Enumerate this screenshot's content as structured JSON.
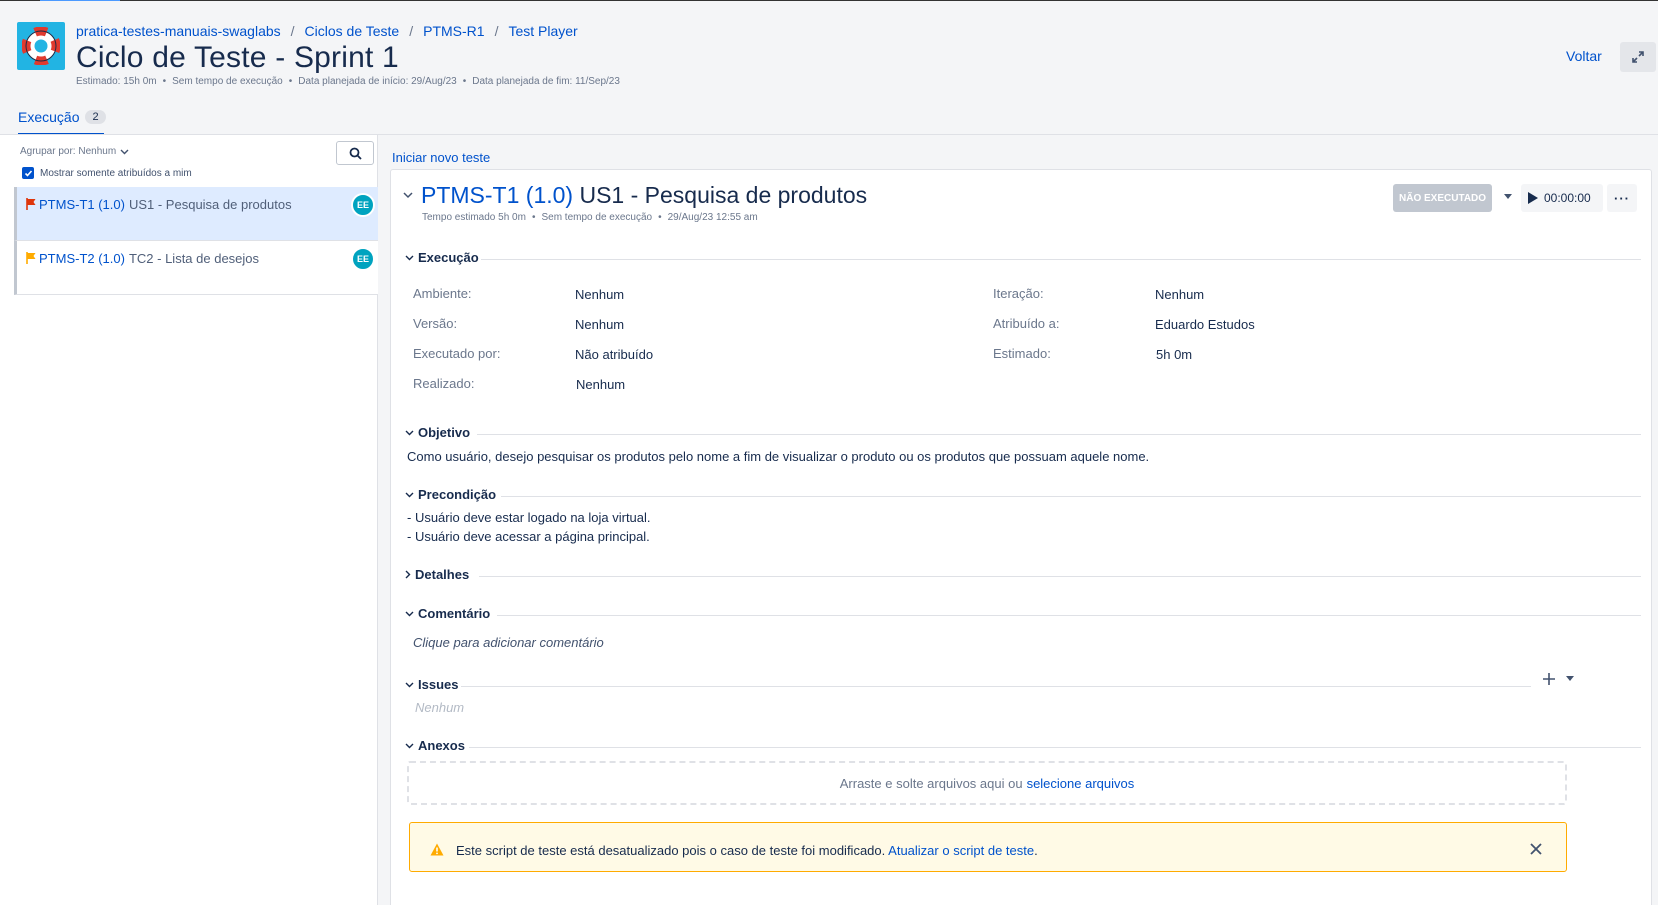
{
  "breadcrumb": {
    "project": "pratica-testes-manuais-swaglabs",
    "cycles": "Ciclos de Teste",
    "cycle_key": "PTMS-R1",
    "player": "Test Player",
    "sep": "/"
  },
  "header": {
    "title": "Ciclo de Teste - Sprint 1",
    "estimated": "Estimado: 15h 0m",
    "no_exec_time": "Sem tempo de execução",
    "planned_start": "Data planejada de início: 29/Aug/23",
    "planned_end": "Data planejada de fim: 11/Sep/23",
    "back": "Voltar"
  },
  "tabs": {
    "execution_label": "Execução",
    "execution_count": "2"
  },
  "sidebar": {
    "group_by": "Agrupar por: Nenhum",
    "only_assigned": "Mostrar somente atribuídos a mim",
    "items": [
      {
        "key": "PTMS-T1 (1.0)",
        "title": "US1 - Pesquisa de produtos",
        "avatar": "EE",
        "flag_color": "#de350b"
      },
      {
        "key": "PTMS-T2 (1.0)",
        "title": "TC2 - Lista de desejos",
        "avatar": "EE",
        "flag_color": "#ffab00"
      }
    ]
  },
  "main": {
    "new_test": "Iniciar novo teste",
    "test_key": "PTMS-T1 (1.0)",
    "test_title": "US1 - Pesquisa de produtos",
    "meta_estimated": "Tempo estimado 5h 0m",
    "meta_no_exec": "Sem tempo de execução",
    "meta_date": "29/Aug/23 12:55 am",
    "status": "NÃO EXECUTADO",
    "timer": "00:00:00",
    "more": "···",
    "execution": {
      "heading": "Execução",
      "environment_label": "Ambiente:",
      "environment_value": "Nenhum",
      "version_label": "Versão:",
      "version_value": "Nenhum",
      "executed_by_label": "Executado por:",
      "executed_by_value": "Não atribuído",
      "done_label": "Realizado:",
      "done_value": "Nenhum",
      "iteration_label": "Iteração:",
      "iteration_value": "Nenhum",
      "assigned_label": "Atribuído a:",
      "assigned_value": "Eduardo Estudos",
      "estimated_label": "Estimado:",
      "estimated_value": "5h 0m"
    },
    "objective": {
      "heading": "Objetivo",
      "text": "Como usuário, desejo pesquisar os produtos pelo nome a fim de visualizar o produto ou os produtos que possuam aquele nome."
    },
    "precondition": {
      "heading": "Precondição",
      "line1": "- Usuário deve estar logado na loja virtual.",
      "line2": "- Usuário deve acessar a página principal."
    },
    "details": {
      "heading": "Detalhes"
    },
    "comment": {
      "heading": "Comentário",
      "placeholder": "Clique para adicionar comentário"
    },
    "issues": {
      "heading": "Issues",
      "empty": "Nenhum"
    },
    "attachments": {
      "heading": "Anexos",
      "drop_text": "Arraste e solte arquivos aqui ou",
      "select_link": "selecione arquivos"
    },
    "warning": {
      "text": "Este script de teste está desatualizado pois o caso de teste foi modificado.",
      "link": "Atualizar o script de teste",
      "tail": "."
    }
  },
  "colors": {
    "accent": "#0052cc",
    "status_gray": "#c1c7d0",
    "warning": "#ffab00",
    "avatar": "#00a3bf"
  }
}
